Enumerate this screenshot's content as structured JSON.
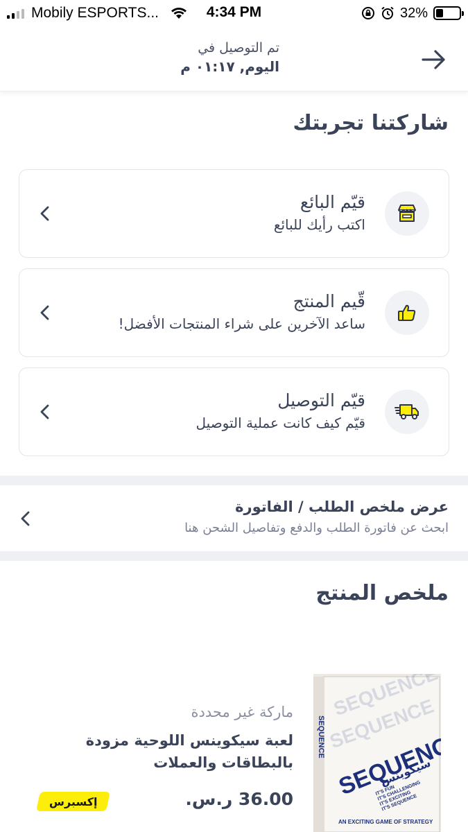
{
  "status_bar": {
    "carrier": "Mobily ESPORTS...",
    "time": "4:34 PM",
    "battery_percent": "32%",
    "battery_level": 0.32
  },
  "header": {
    "delivered_label": "تم التوصيل في",
    "delivered_date": "اليوم, ٠١:١٧ م",
    "back_icon": "arrow-right-icon"
  },
  "experience": {
    "title": "شاركتنا تجربتك",
    "cards": [
      {
        "title": "قيّم البائع",
        "subtitle": "اكتب رأيك للبائع",
        "icon": "store-icon"
      },
      {
        "title": "قّيم المنتج",
        "subtitle": "ساعد الآخرين على شراء المنتجات الأفضل!",
        "icon": "thumbs-up-icon"
      },
      {
        "title": "قيّم التوصيل",
        "subtitle": "قيّم كيف كانت عملية التوصيل",
        "icon": "delivery-truck-icon"
      }
    ]
  },
  "order_summary": {
    "title": "عرض ملخص الطلب / الفاتورة",
    "subtitle": "ابحث عن فاتورة الطلب والدفع وتفاصيل الشحن هنا"
  },
  "product_summary": {
    "title": "ملخص المنتج",
    "brand": "ماركة غير محددة",
    "name": "لعبة سيكوينس اللوحية مزودة بالبطاقات والعملات",
    "price": "36.00 ر.س.",
    "badge": "إكسبرس",
    "box_text": {
      "logo": "SEQUENCE",
      "arabic_logo": "سيكوينس",
      "taglines": [
        "IT'S FUN",
        "IT'S CHALLENGING",
        "IT'S EXCITING",
        "IT'S SEQUENCE"
      ],
      "bottom": "AN EXCITING GAME OF STRATEGY"
    }
  },
  "colors": {
    "accent_yellow": "#fcee0a",
    "text_dark": "#3b4358",
    "divider": "#eef0f3"
  }
}
